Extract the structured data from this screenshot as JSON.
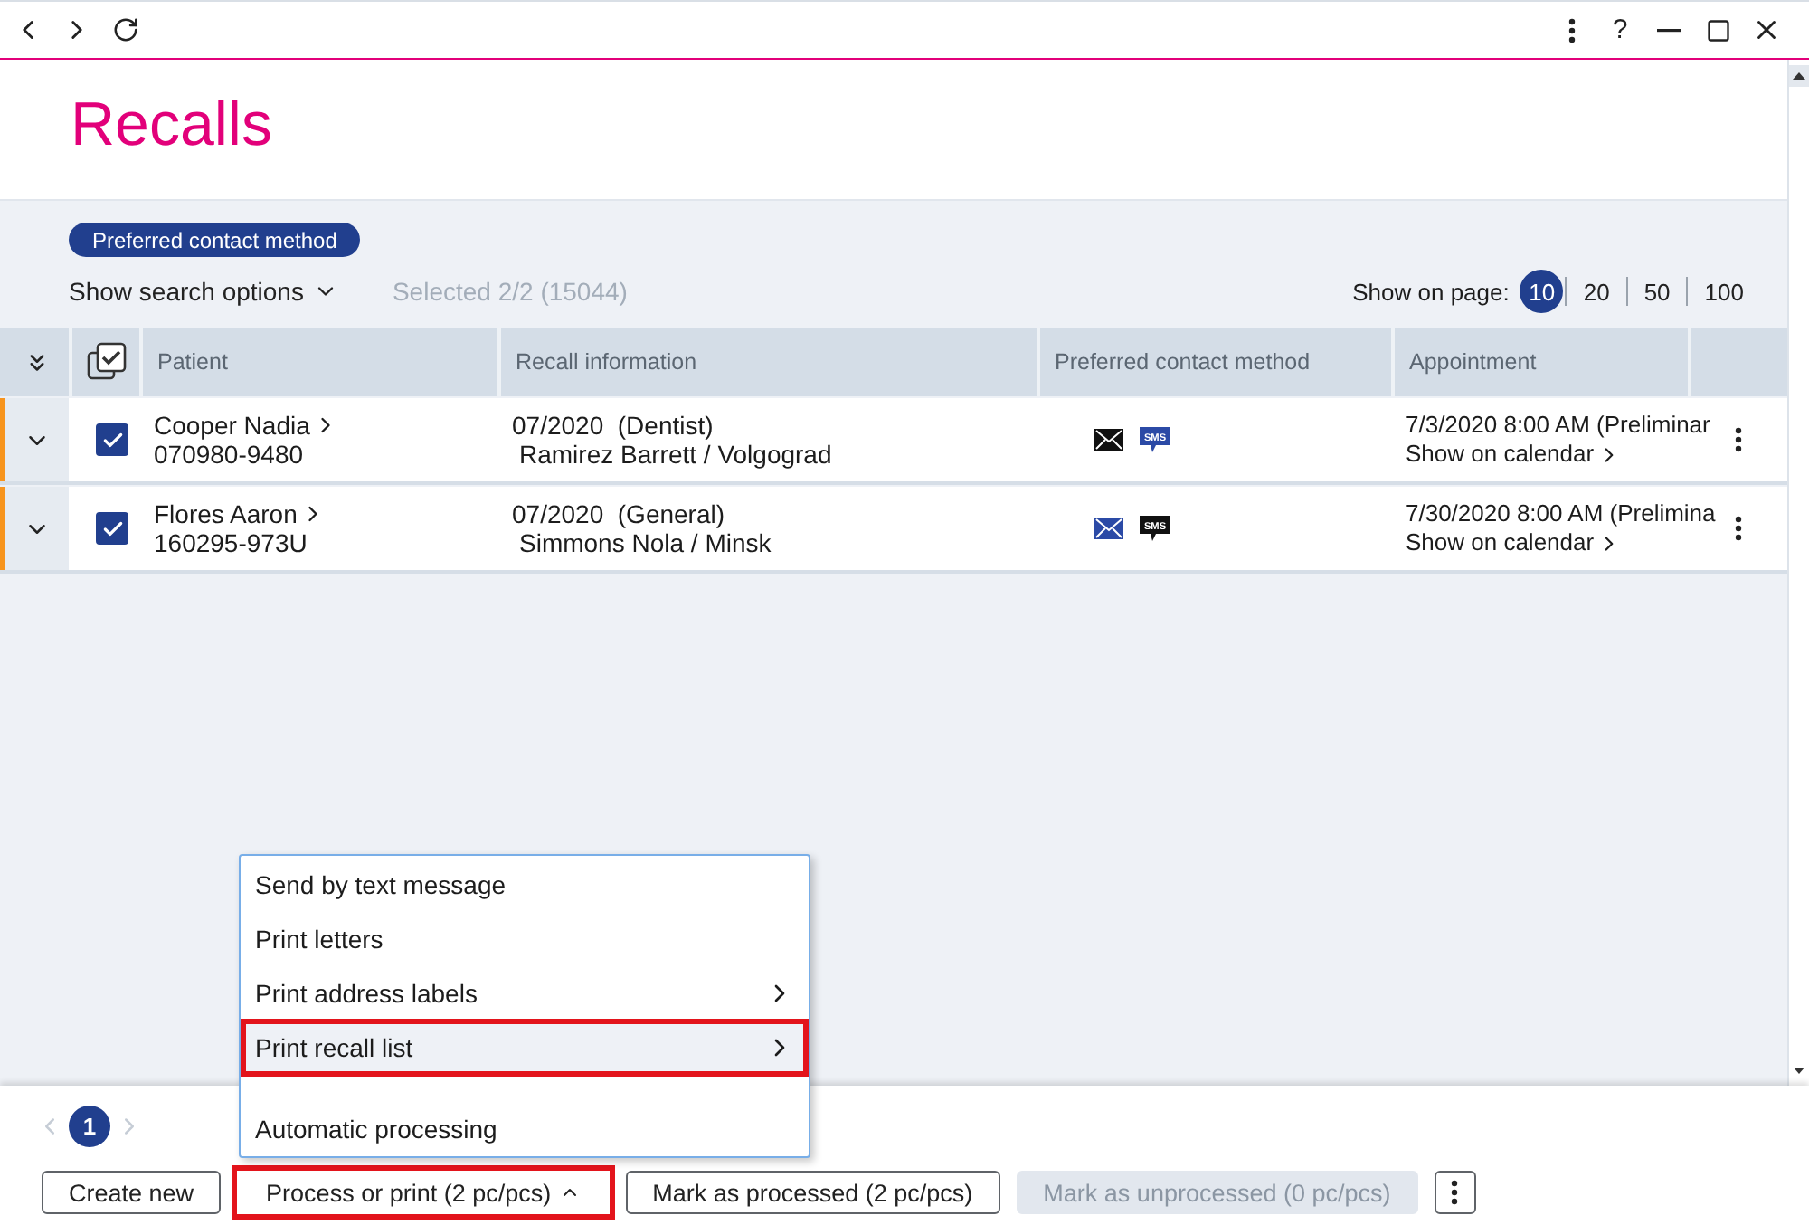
{
  "window_controls": {
    "help": "?"
  },
  "page": {
    "title": "Recalls"
  },
  "filters": {
    "chips": [
      {
        "label": "Preferred contact method"
      }
    ],
    "search_toggle": "Show search options",
    "selection_summary": "Selected 2/2 (15044)"
  },
  "page_size": {
    "label": "Show on page:",
    "options": [
      {
        "label": "10",
        "selected": true
      },
      {
        "label": "20",
        "selected": false
      },
      {
        "label": "50",
        "selected": false
      },
      {
        "label": "100",
        "selected": false
      }
    ]
  },
  "table": {
    "columns": [
      {
        "label": "Patient"
      },
      {
        "label": "Recall information"
      },
      {
        "label": "Preferred contact method"
      },
      {
        "label": "Appointment"
      }
    ],
    "rows": [
      {
        "flagged": true,
        "expanded": false,
        "checked": true,
        "patient": "Cooper Nadia",
        "patient_id": "070980-9480",
        "recall": "07/2020  (Dentist)",
        "recall_detail": "Ramirez Barrett / Volgograd",
        "contact_methods": [
          {
            "kind": "email",
            "preferred": false
          },
          {
            "kind": "sms",
            "label": "SMS",
            "preferred": true
          }
        ],
        "appointment": "7/3/2020 8:00 AM (Preliminar",
        "calendar_link": "Show on calendar"
      },
      {
        "flagged": true,
        "expanded": false,
        "checked": true,
        "patient": "Flores Aaron",
        "patient_id": "160295-973U",
        "recall": "07/2020  (General)",
        "recall_detail": "Simmons Nola / Minsk",
        "contact_methods": [
          {
            "kind": "email",
            "preferred": true
          },
          {
            "kind": "sms",
            "label": "SMS",
            "preferred": false
          }
        ],
        "appointment": "7/30/2020 8:00 AM (Prelimina",
        "calendar_link": "Show on calendar"
      }
    ]
  },
  "pagination": {
    "pages": [
      {
        "label": "1",
        "selected": true
      }
    ]
  },
  "buttons": [
    {
      "kind": "button",
      "label": "Create new",
      "disabled": false,
      "highlighted": false
    },
    {
      "kind": "menu",
      "label": "Process or print (2 pc/pcs)",
      "expanded": true,
      "disabled": false,
      "highlighted": true
    },
    {
      "kind": "button",
      "label": "Mark as processed (2 pc/pcs)",
      "disabled": false,
      "highlighted": false
    },
    {
      "kind": "button",
      "label": "Mark as unprocessed (0 pc/pcs)",
      "disabled": true,
      "highlighted": false
    },
    {
      "kind": "more",
      "disabled": false,
      "highlighted": false
    }
  ],
  "process_menu": {
    "groups": [
      {
        "items": [
          {
            "label": "Send by text message",
            "submenu": false,
            "highlighted": false
          },
          {
            "label": "Print letters",
            "submenu": false,
            "highlighted": false
          },
          {
            "label": "Print address labels",
            "submenu": true,
            "highlighted": false
          },
          {
            "label": "Print recall list",
            "submenu": true,
            "highlighted": true
          }
        ]
      },
      {
        "items": [
          {
            "label": "Automatic processing",
            "submenu": false,
            "highlighted": false
          }
        ]
      }
    ]
  }
}
